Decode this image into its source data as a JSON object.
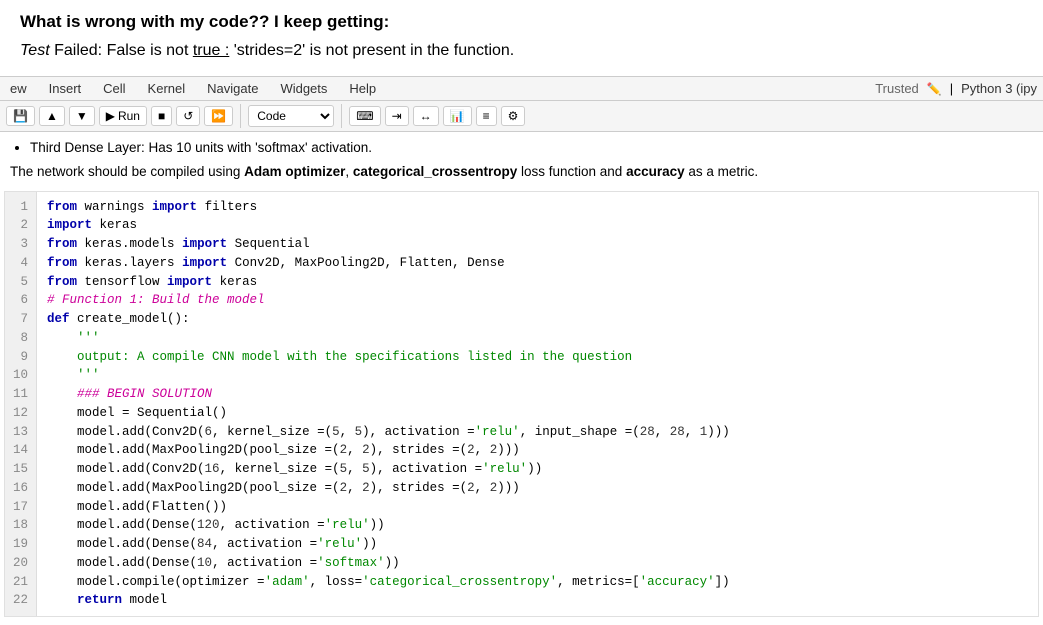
{
  "question": {
    "title": "What is wrong with my code?? I keep getting:",
    "subtitle_italic": "Test",
    "subtitle_rest": " Failed: False is not ",
    "subtitle_underline": "true :",
    "subtitle_end": " 'strides=2' is not present in the function."
  },
  "menu": {
    "items": [
      "ew",
      "Insert",
      "Cell",
      "Kernel",
      "Navigate",
      "Widgets",
      "Help"
    ],
    "trusted": "Trusted",
    "kernel": "Python 3 (ipy"
  },
  "toolbar": {
    "run_label": "Run",
    "cell_type": "Code"
  },
  "description": {
    "bullet": "Third Dense Layer: Has 10 units with 'softmax' activation.",
    "network_text_pre": "The network should be compiled using ",
    "optimizer": "Adam optimizer",
    "loss_sep": ", ",
    "loss": "categorical_crossentropy",
    "loss_post": " loss function and ",
    "metric": "accuracy",
    "metric_post": " as a metric."
  },
  "code": {
    "lines": [
      {
        "num": 1,
        "text": "from warnings import filters"
      },
      {
        "num": 2,
        "text": "import keras"
      },
      {
        "num": 3,
        "text": "from keras.models import Sequential"
      },
      {
        "num": 4,
        "text": "from keras.layers import Conv2D, MaxPooling2D, Flatten, Dense"
      },
      {
        "num": 5,
        "text": "from tensorflow import keras"
      },
      {
        "num": 6,
        "text": "# Function 1: Build the model"
      },
      {
        "num": 7,
        "text": "def create_model():"
      },
      {
        "num": 8,
        "text": "    '''"
      },
      {
        "num": 9,
        "text": "    output: A compile CNN model with the specifications listed in the question"
      },
      {
        "num": 10,
        "text": "    '''"
      },
      {
        "num": 11,
        "text": "    ### BEGIN SOLUTION"
      },
      {
        "num": 12,
        "text": "    model = Sequential()"
      },
      {
        "num": 13,
        "text": "    model.add(Conv2D(6, kernel_size =(5, 5), activation ='relu', input_shape =(28, 28, 1)))"
      },
      {
        "num": 14,
        "text": "    model.add(MaxPooling2D(pool_size =(2, 2), strides =(2, 2)))"
      },
      {
        "num": 15,
        "text": "    model.add(Conv2D(16, kernel_size =(5, 5), activation ='relu'))"
      },
      {
        "num": 16,
        "text": "    model.add(MaxPooling2D(pool_size =(2, 2), strides =(2, 2)))"
      },
      {
        "num": 17,
        "text": "    model.add(Flatten())"
      },
      {
        "num": 18,
        "text": "    model.add(Dense(120, activation ='relu'))"
      },
      {
        "num": 19,
        "text": "    model.add(Dense(84, activation ='relu'))"
      },
      {
        "num": 20,
        "text": "    model.add(Dense(10, activation ='softmax'))"
      },
      {
        "num": 21,
        "text": "    model.compile(optimizer ='adam', loss='categorical_crossentropy', metrics=['accuracy'])"
      },
      {
        "num": 22,
        "text": "    return model"
      }
    ]
  }
}
